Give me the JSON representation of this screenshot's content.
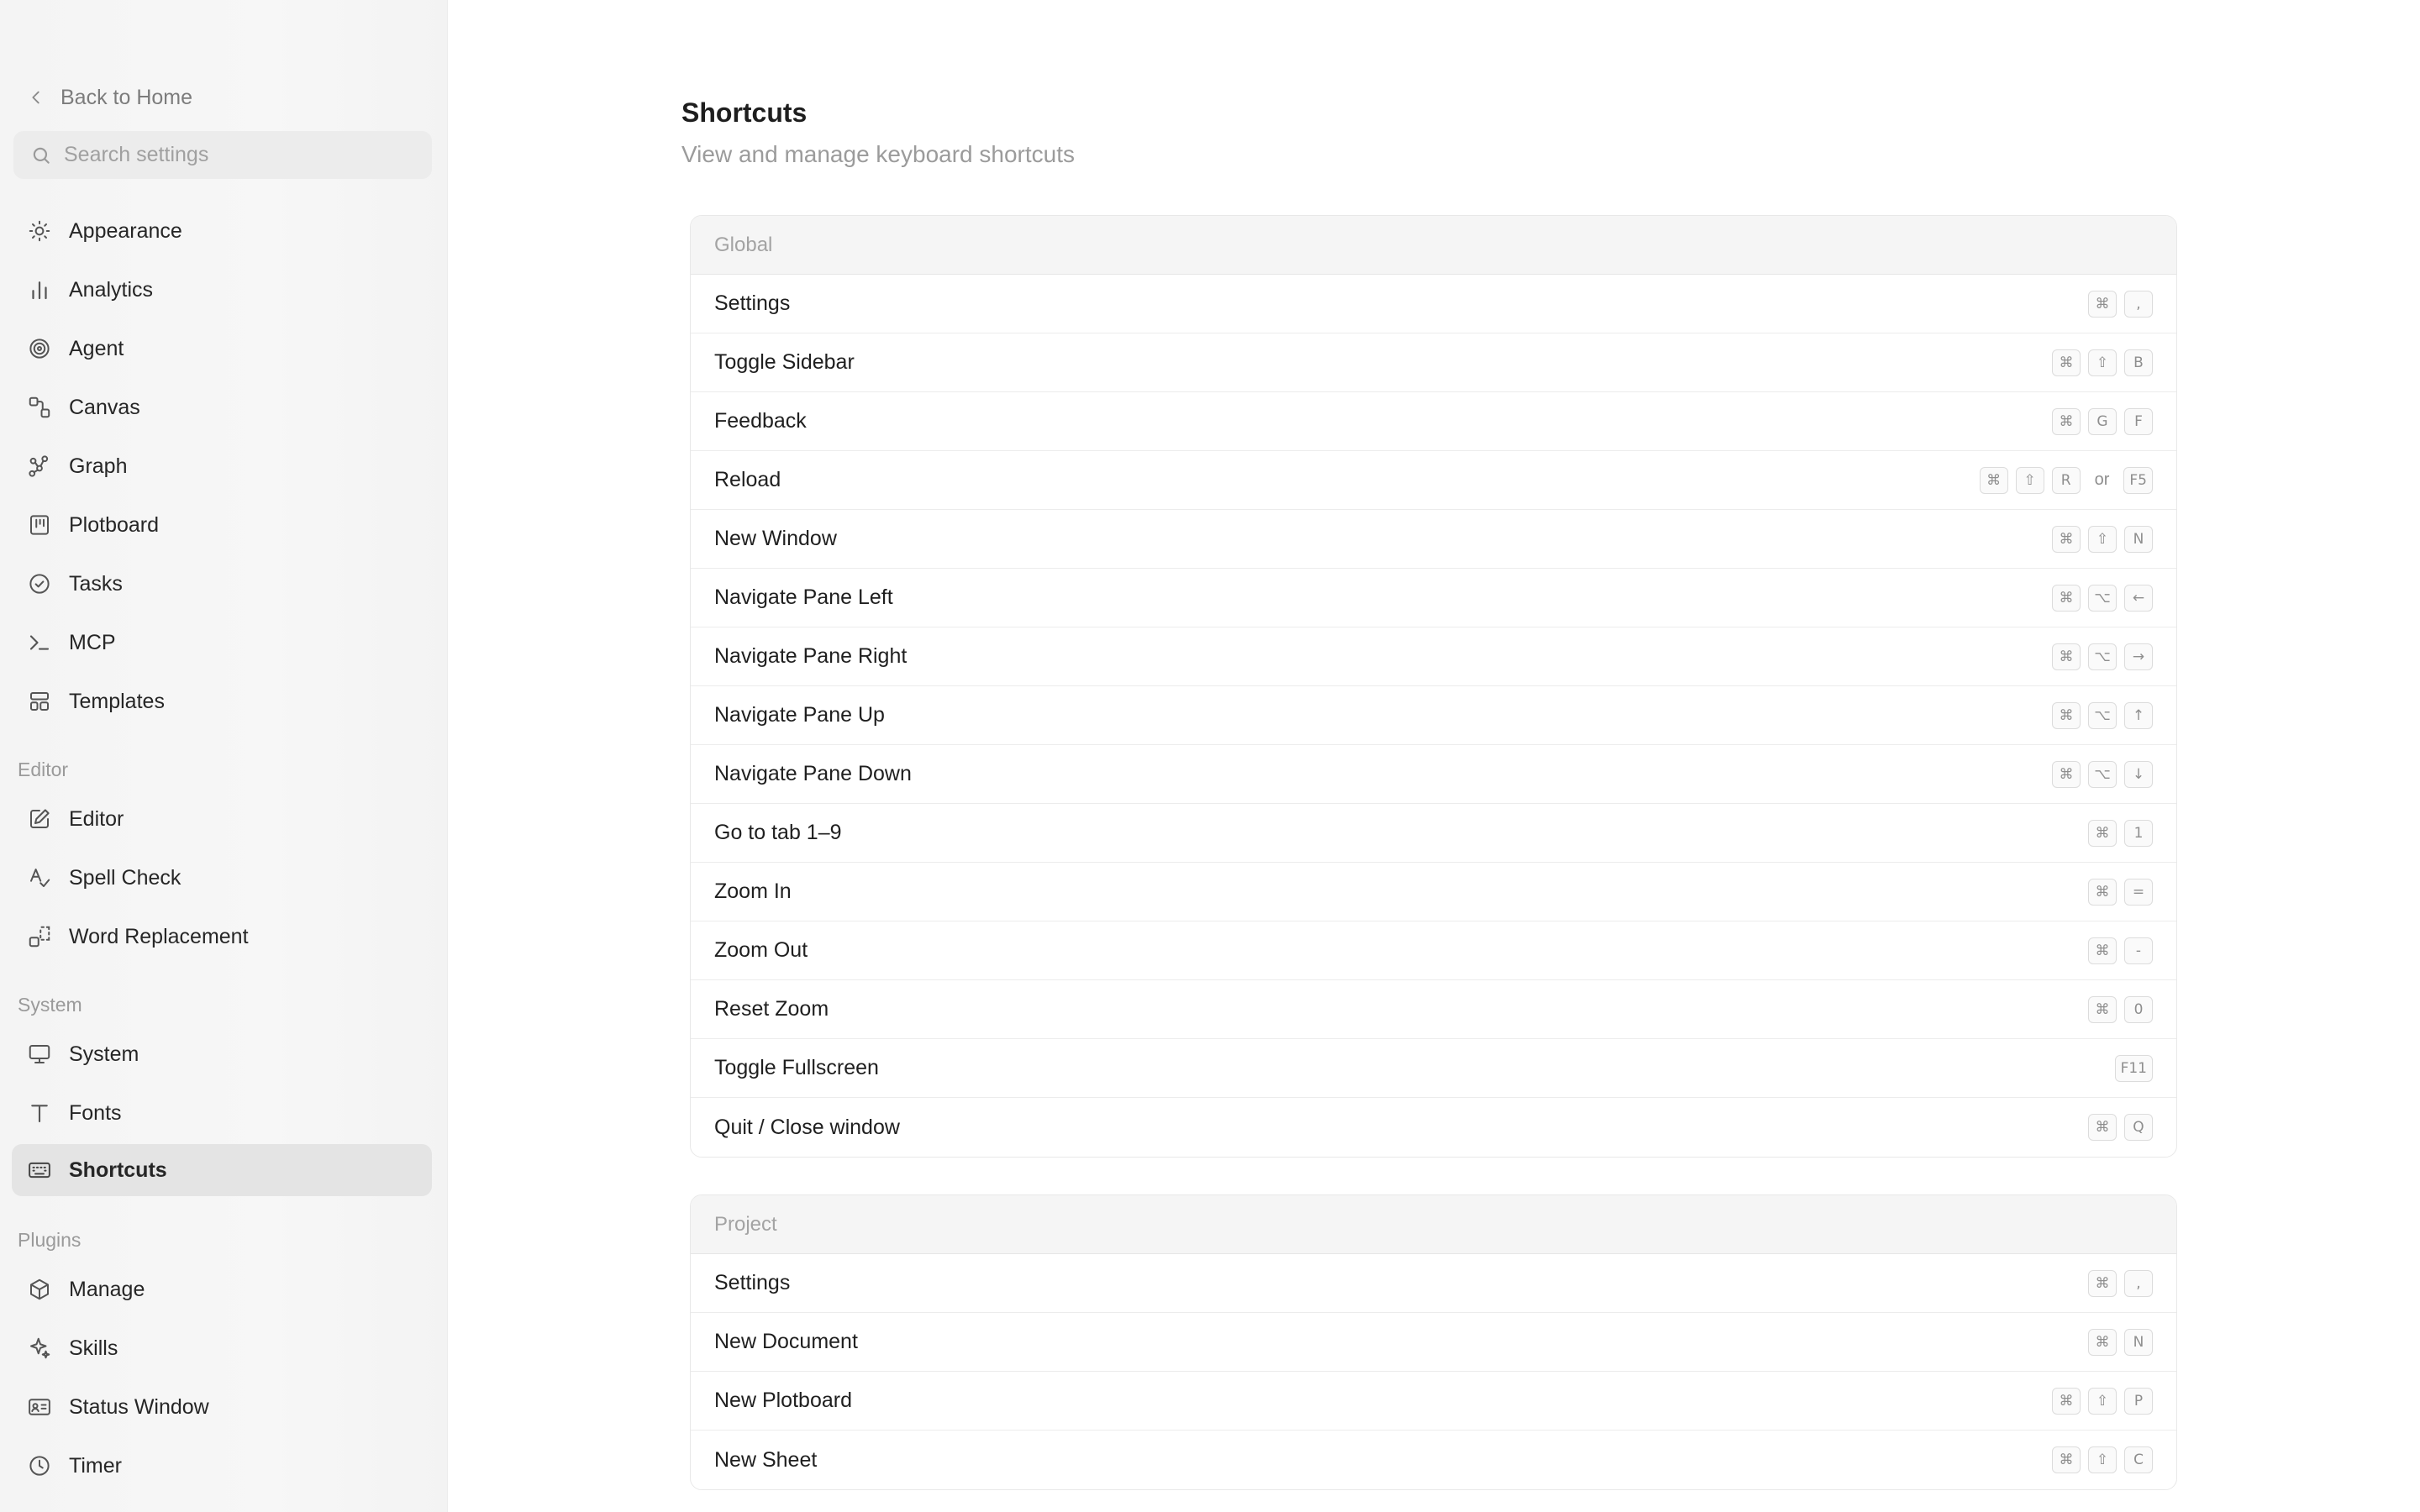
{
  "sidebar": {
    "back_label": "Back to Home",
    "search_placeholder": "Search settings",
    "items": [
      {
        "label": "Appearance",
        "icon": "sun-icon"
      },
      {
        "label": "Analytics",
        "icon": "bar-chart-icon"
      },
      {
        "label": "Agent",
        "icon": "spiral-icon"
      },
      {
        "label": "Canvas",
        "icon": "canvas-icon"
      },
      {
        "label": "Graph",
        "icon": "graph-icon"
      },
      {
        "label": "Plotboard",
        "icon": "plotboard-icon"
      },
      {
        "label": "Tasks",
        "icon": "check-circle-icon"
      },
      {
        "label": "MCP",
        "icon": "terminal-icon"
      },
      {
        "label": "Templates",
        "icon": "templates-icon"
      }
    ],
    "editor_section": {
      "label": "Editor",
      "items": [
        {
          "label": "Editor",
          "icon": "edit-icon"
        },
        {
          "label": "Spell Check",
          "icon": "spell-check-icon"
        },
        {
          "label": "Word Replacement",
          "icon": "replace-icon"
        }
      ]
    },
    "system_section": {
      "label": "System",
      "items": [
        {
          "label": "System",
          "icon": "monitor-icon"
        },
        {
          "label": "Fonts",
          "icon": "type-icon"
        },
        {
          "label": "Shortcuts",
          "icon": "keyboard-icon",
          "active": true
        }
      ]
    },
    "plugins_section": {
      "label": "Plugins",
      "items": [
        {
          "label": "Manage",
          "icon": "package-icon"
        },
        {
          "label": "Skills",
          "icon": "sparkles-icon"
        },
        {
          "label": "Status Window",
          "icon": "id-card-icon"
        },
        {
          "label": "Timer",
          "icon": "clock-icon"
        }
      ]
    }
  },
  "main": {
    "title": "Shortcuts",
    "subtitle": "View and manage keyboard shortcuts",
    "groups": [
      {
        "header": "Global",
        "rows": [
          {
            "label": "Settings",
            "keys": [
              "⌘",
              ","
            ]
          },
          {
            "label": "Toggle Sidebar",
            "keys": [
              "⌘",
              "⇧",
              "B"
            ]
          },
          {
            "label": "Feedback",
            "keys": [
              "⌘",
              "G",
              "F"
            ]
          },
          {
            "label": "Reload",
            "keys": [
              "⌘",
              "⇧",
              "R"
            ],
            "alt_sep": "or",
            "alt_keys": [
              "F5"
            ]
          },
          {
            "label": "New Window",
            "keys": [
              "⌘",
              "⇧",
              "N"
            ]
          },
          {
            "label": "Navigate Pane Left",
            "keys": [
              "⌘",
              "⌥",
              "←"
            ]
          },
          {
            "label": "Navigate Pane Right",
            "keys": [
              "⌘",
              "⌥",
              "→"
            ]
          },
          {
            "label": "Navigate Pane Up",
            "keys": [
              "⌘",
              "⌥",
              "↑"
            ]
          },
          {
            "label": "Navigate Pane Down",
            "keys": [
              "⌘",
              "⌥",
              "↓"
            ]
          },
          {
            "label": "Go to tab 1–9",
            "keys": [
              "⌘",
              "1"
            ]
          },
          {
            "label": "Zoom In",
            "keys": [
              "⌘",
              "="
            ]
          },
          {
            "label": "Zoom Out",
            "keys": [
              "⌘",
              "-"
            ]
          },
          {
            "label": "Reset Zoom",
            "keys": [
              "⌘",
              "0"
            ]
          },
          {
            "label": "Toggle Fullscreen",
            "keys": [
              "F11"
            ]
          },
          {
            "label": "Quit / Close window",
            "keys": [
              "⌘",
              "Q"
            ]
          }
        ]
      },
      {
        "header": "Project",
        "rows": [
          {
            "label": "Settings",
            "keys": [
              "⌘",
              ","
            ]
          },
          {
            "label": "New Document",
            "keys": [
              "⌘",
              "N"
            ]
          },
          {
            "label": "New Plotboard",
            "keys": [
              "⌘",
              "⇧",
              "P"
            ]
          },
          {
            "label": "New Sheet",
            "keys": [
              "⌘",
              "⇧",
              "C"
            ]
          }
        ]
      }
    ]
  }
}
